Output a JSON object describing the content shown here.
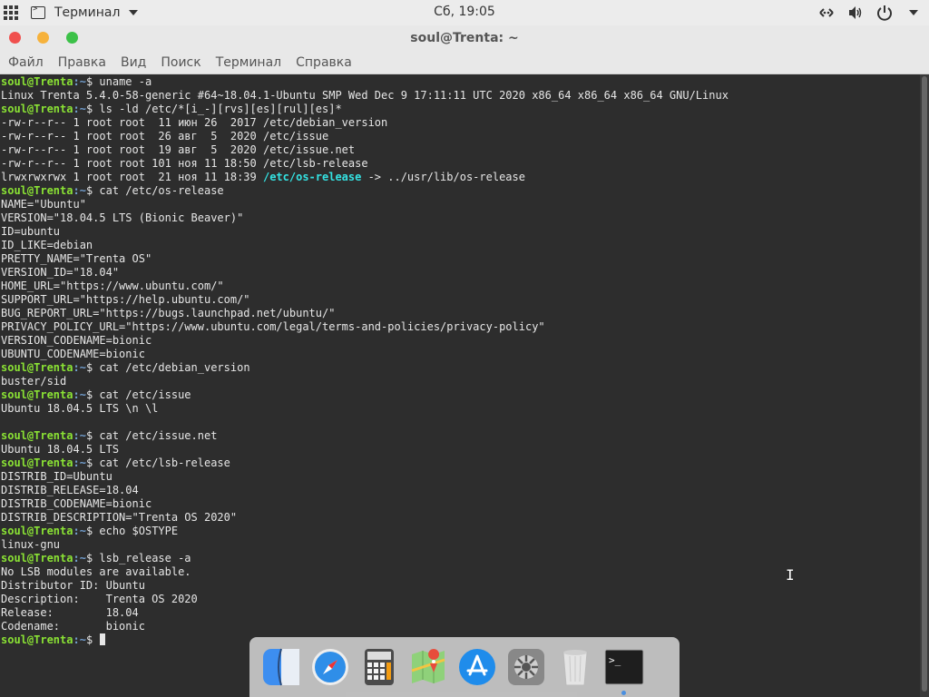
{
  "topbar": {
    "app_name": "Терминал",
    "clock": "Сб, 19:05"
  },
  "window": {
    "title": "soul@Trenta: ~"
  },
  "menu": [
    "Файл",
    "Правка",
    "Вид",
    "Поиск",
    "Терминал",
    "Справка"
  ],
  "terminal": {
    "prompt_user": "soul@Trenta",
    "prompt_path": ":~",
    "prompt_sign": "$ ",
    "lines": [
      {
        "type": "cmd",
        "text": "uname -a"
      },
      {
        "type": "out",
        "text": "Linux Trenta 5.4.0-58-generic #64~18.04.1-Ubuntu SMP Wed Dec 9 17:11:11 UTC 2020 x86_64 x86_64 x86_64 GNU/Linux"
      },
      {
        "type": "cmd",
        "text": "ls -ld /etc/*[i_-][rvs][es][rul][es]*"
      },
      {
        "type": "out",
        "text": "-rw-r--r-- 1 root root  11 июн 26  2017 /etc/debian_version"
      },
      {
        "type": "out",
        "text": "-rw-r--r-- 1 root root  26 авг  5  2020 /etc/issue"
      },
      {
        "type": "out",
        "text": "-rw-r--r-- 1 root root  19 авг  5  2020 /etc/issue.net"
      },
      {
        "type": "out",
        "text": "-rw-r--r-- 1 root root 101 ноя 11 18:50 /etc/lsb-release"
      },
      {
        "type": "link",
        "text": "lrwxrwxrwx 1 root root  21 ноя 11 18:39 ",
        "link": "/etc/os-release",
        "rest": " -> ../usr/lib/os-release"
      },
      {
        "type": "cmd",
        "text": "cat /etc/os-release"
      },
      {
        "type": "out",
        "text": "NAME=\"Ubuntu\""
      },
      {
        "type": "out",
        "text": "VERSION=\"18.04.5 LTS (Bionic Beaver)\""
      },
      {
        "type": "out",
        "text": "ID=ubuntu"
      },
      {
        "type": "out",
        "text": "ID_LIKE=debian"
      },
      {
        "type": "out",
        "text": "PRETTY_NAME=\"Trenta OS\""
      },
      {
        "type": "out",
        "text": "VERSION_ID=\"18.04\""
      },
      {
        "type": "out",
        "text": "HOME_URL=\"https://www.ubuntu.com/\""
      },
      {
        "type": "out",
        "text": "SUPPORT_URL=\"https://help.ubuntu.com/\""
      },
      {
        "type": "out",
        "text": "BUG_REPORT_URL=\"https://bugs.launchpad.net/ubuntu/\""
      },
      {
        "type": "out",
        "text": "PRIVACY_POLICY_URL=\"https://www.ubuntu.com/legal/terms-and-policies/privacy-policy\""
      },
      {
        "type": "out",
        "text": "VERSION_CODENAME=bionic"
      },
      {
        "type": "out",
        "text": "UBUNTU_CODENAME=bionic"
      },
      {
        "type": "cmd",
        "text": "cat /etc/debian_version"
      },
      {
        "type": "out",
        "text": "buster/sid"
      },
      {
        "type": "cmd",
        "text": "cat /etc/issue"
      },
      {
        "type": "out",
        "text": "Ubuntu 18.04.5 LTS \\n \\l"
      },
      {
        "type": "out",
        "text": ""
      },
      {
        "type": "cmd",
        "text": "cat /etc/issue.net"
      },
      {
        "type": "out",
        "text": "Ubuntu 18.04.5 LTS"
      },
      {
        "type": "cmd",
        "text": "cat /etc/lsb-release"
      },
      {
        "type": "out",
        "text": "DISTRIB_ID=Ubuntu"
      },
      {
        "type": "out",
        "text": "DISTRIB_RELEASE=18.04"
      },
      {
        "type": "out",
        "text": "DISTRIB_CODENAME=bionic"
      },
      {
        "type": "out",
        "text": "DISTRIB_DESCRIPTION=\"Trenta OS 2020\""
      },
      {
        "type": "cmd",
        "text": "echo $OSTYPE"
      },
      {
        "type": "out",
        "text": "linux-gnu"
      },
      {
        "type": "cmd",
        "text": "lsb_release -a"
      },
      {
        "type": "out",
        "text": "No LSB modules are available."
      },
      {
        "type": "out",
        "text": "Distributor ID:\tUbuntu"
      },
      {
        "type": "out",
        "text": "Description:\tTrenta OS 2020"
      },
      {
        "type": "out",
        "text": "Release:\t18.04"
      },
      {
        "type": "out",
        "text": "Codename:\tbionic"
      },
      {
        "type": "prompt",
        "text": ""
      }
    ]
  },
  "dock": {
    "items": [
      {
        "name": "finder-icon"
      },
      {
        "name": "safari-icon"
      },
      {
        "name": "calculator-icon",
        "label": "47,121"
      },
      {
        "name": "maps-icon"
      },
      {
        "name": "app-store-icon"
      },
      {
        "name": "system-settings-icon"
      },
      {
        "name": "trash-icon"
      },
      {
        "name": "terminal-icon",
        "label": ">_",
        "running": true
      }
    ]
  },
  "colors": {
    "prompt_user": "#8ae234",
    "prompt_path": "#729fcf",
    "symlink": "#34e2e2",
    "terminal_bg": "#2d2d2d",
    "close": "#f0504e",
    "minimize": "#f6b23c",
    "maximize": "#3cc148"
  }
}
